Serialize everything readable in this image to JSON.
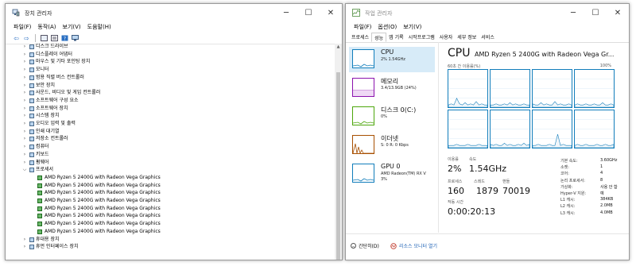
{
  "device_manager": {
    "title": "장치 관리자",
    "menu": [
      "파일(F)",
      "동작(A)",
      "보기(V)",
      "도움말(H)"
    ],
    "tree_items": [
      {
        "label": "디스크 드라이브",
        "expanded": false
      },
      {
        "label": "디스플레이 어댑터",
        "expanded": false
      },
      {
        "label": "마우스 및 기타 포인팅 장치",
        "expanded": false
      },
      {
        "label": "모니터",
        "expanded": false
      },
      {
        "label": "범용 직렬 버스 컨트롤러",
        "expanded": false
      },
      {
        "label": "보안 장치",
        "expanded": false
      },
      {
        "label": "사운드, 비디오 및 게임 컨트롤러",
        "expanded": false
      },
      {
        "label": "소프트웨어 구성 요소",
        "expanded": false
      },
      {
        "label": "소프트웨어 장치",
        "expanded": false
      },
      {
        "label": "시스템 장치",
        "expanded": false
      },
      {
        "label": "오디오 입력 및 출력",
        "expanded": false
      },
      {
        "label": "인쇄 대기열",
        "expanded": false
      },
      {
        "label": "저장소 컨트롤러",
        "expanded": false
      },
      {
        "label": "컴퓨터",
        "expanded": false
      },
      {
        "label": "키보드",
        "expanded": false
      },
      {
        "label": "펌웨어",
        "expanded": false
      },
      {
        "label": "프로세서",
        "expanded": true
      }
    ],
    "processors": [
      "AMD Ryzen 5 2400G with Radeon Vega Graphics",
      "AMD Ryzen 5 2400G with Radeon Vega Graphics",
      "AMD Ryzen 5 2400G with Radeon Vega Graphics",
      "AMD Ryzen 5 2400G with Radeon Vega Graphics",
      "AMD Ryzen 5 2400G with Radeon Vega Graphics",
      "AMD Ryzen 5 2400G with Radeon Vega Graphics",
      "AMD Ryzen 5 2400G with Radeon Vega Graphics",
      "AMD Ryzen 5 2400G with Radeon Vega Graphics"
    ],
    "after_items": [
      {
        "label": "휴대용 장치",
        "expanded": false
      },
      {
        "label": "휴먼 인터페이스 장치",
        "expanded": false
      }
    ]
  },
  "task_manager": {
    "title": "작업 관리자",
    "menu": [
      "파일(F)",
      "옵션(O)",
      "보기(V)"
    ],
    "tabs": [
      "프로세스",
      "성능",
      "앱 기록",
      "시작프로그램",
      "사용자",
      "세부 정보",
      "서비스"
    ],
    "active_tab": "성능",
    "resources": [
      {
        "name": "CPU",
        "sub": "2% 1.54GHz",
        "sub2": "",
        "color": "#117dbb",
        "selected": true
      },
      {
        "name": "메모리",
        "sub": "3.4/13.9GB (24%)",
        "sub2": "",
        "color": "#8b12ae",
        "selected": false
      },
      {
        "name": "디스크 0(C:)",
        "sub": "0%",
        "sub2": "",
        "color": "#4da60c",
        "selected": false
      },
      {
        "name": "이더넷",
        "sub": "S: 0 R: 0 Kbps",
        "sub2": "",
        "color": "#a74f01",
        "selected": false
      },
      {
        "name": "GPU 0",
        "sub": "AMD Radeon(TM) RX V",
        "sub2": "3%",
        "color": "#117dbb",
        "selected": false
      }
    ],
    "detail": {
      "heading": "CPU",
      "model": "AMD Ryzen 5 2400G with Radeon Vega Gr...",
      "graph_label": "60초 간 이용률(%)",
      "graph_max": "100%",
      "stats": {
        "util_label": "이용률",
        "util_value": "2%",
        "speed_label": "속도",
        "speed_value": "1.54GHz",
        "proc_label": "프로세스",
        "proc_value": "160",
        "thread_label": "스레드",
        "thread_value": "1879",
        "handle_label": "핸들",
        "handle_value": "70019",
        "uptime_label": "작동 시간",
        "uptime_value": "0:00:20:13"
      },
      "specs": [
        {
          "k": "기본 속도:",
          "v": "3.60GHz"
        },
        {
          "k": "소켓:",
          "v": "1"
        },
        {
          "k": "코어:",
          "v": "4"
        },
        {
          "k": "논리 프로세서:",
          "v": "8"
        },
        {
          "k": "가상화:",
          "v": "사용 안 함"
        },
        {
          "k": "Hyper-V 지원:",
          "v": "예"
        },
        {
          "k": "L1 캐시:",
          "v": "384KB"
        },
        {
          "k": "L2 캐시:",
          "v": "2.0MB"
        },
        {
          "k": "L3 캐시:",
          "v": "4.0MB"
        }
      ]
    },
    "footer": {
      "brief": "간단히(D)",
      "monitor": "리소스 모니터 열기"
    }
  }
}
